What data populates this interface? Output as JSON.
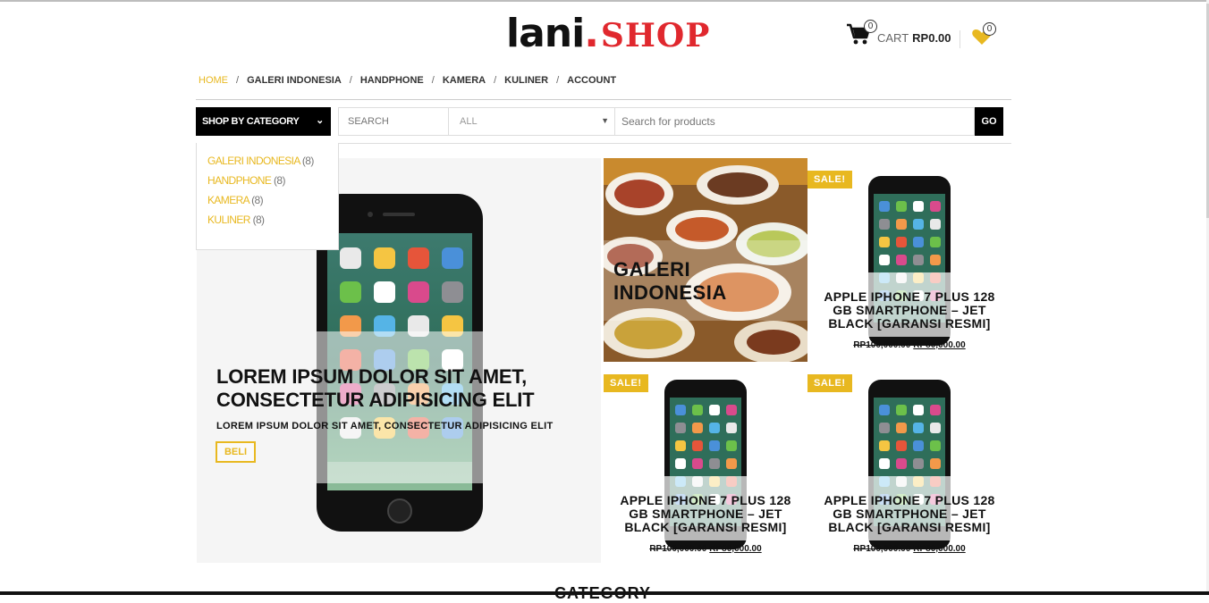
{
  "brand": {
    "name": "lani",
    "dot": ".",
    "suffix": "SHOP"
  },
  "cart": {
    "count": "0",
    "label": "CART",
    "amount": "RP0.00"
  },
  "wishlist": {
    "count": "0"
  },
  "nav": [
    "HOME",
    "GALERI INDONESIA",
    "HANDPHONE",
    "KAMERA",
    "KULINER",
    "ACCOUNT"
  ],
  "search": {
    "shop_by_category": "SHOP BY CATEGORY",
    "search_placeholder": "SEARCH",
    "category_value": "ALL",
    "product_placeholder": "Search for products",
    "go_label": "GO"
  },
  "category_menu": [
    {
      "label": "GALERI INDONESIA",
      "count": "(8)"
    },
    {
      "label": "HANDPHONE",
      "count": "(8)"
    },
    {
      "label": "KAMERA",
      "count": "(8)"
    },
    {
      "label": "KULINER",
      "count": "(8)"
    }
  ],
  "hero": {
    "title": "LOREM IPSUM DOLOR SIT AMET, CONSECTETUR ADIPISICING ELIT",
    "subtitle": "LOREM IPSUM DOLOR SIT AMET, CONSECTETUR ADIPISICING ELIT",
    "button": "BELI"
  },
  "galeri_tile": {
    "title": "GALERI INDONESIA"
  },
  "products": [
    {
      "sale": "SALE!",
      "name": "APPLE IPHONE 7 PLUS 128 GB SMARTPHONE – JET BLACK [GARANSI RESMI]",
      "old_price": "RP100,000.00",
      "new_price": "RP80,000.00"
    },
    {
      "sale": "SALE!",
      "name": "APPLE IPHONE 7 PLUS 128 GB SMARTPHONE – JET BLACK [GARANSI RESMI]",
      "old_price": "RP100,000.00",
      "new_price": "RP80,000.00"
    },
    {
      "sale": "SALE!",
      "name": "APPLE IPHONE 7 PLUS 128 GB SMARTPHONE – JET BLACK [GARANSI RESMI]",
      "old_price": "RP100,000.00",
      "new_price": "RP80,000.00"
    }
  ],
  "section_heading": "CATEGORY",
  "colors": {
    "accent": "#e8b820",
    "brand_red": "#e0282e"
  }
}
